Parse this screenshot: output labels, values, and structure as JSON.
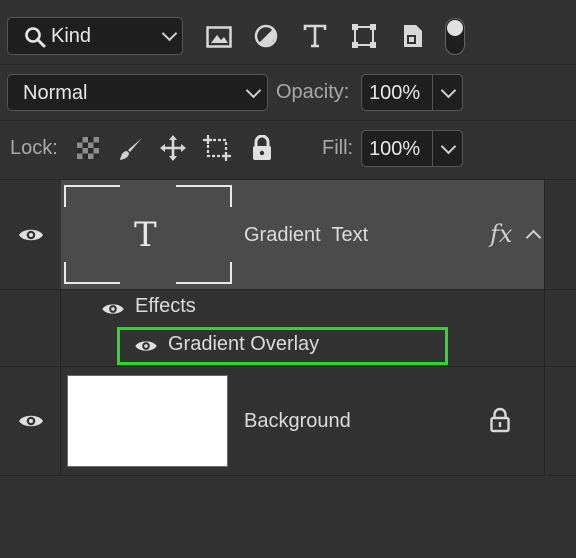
{
  "filter": {
    "kind_label": "Kind",
    "icons": [
      "image-filter-icon",
      "adjustment-filter-icon",
      "type-filter-icon",
      "shape-filter-icon",
      "smart-object-filter-icon",
      "filter-toggle-icon"
    ]
  },
  "blend": {
    "mode": "Normal",
    "opacity_label": "Opacity:",
    "opacity_value": "100%"
  },
  "lock": {
    "label": "Lock:",
    "icons": [
      "lock-transparent-pixels-icon",
      "lock-image-pixels-icon",
      "lock-position-icon",
      "lock-artboard-icon",
      "lock-all-icon"
    ],
    "fill_label": "Fill:",
    "fill_value": "100%"
  },
  "layers": [
    {
      "name": "Gradient  Text",
      "thumb_glyph": "T",
      "fx_label": "fx",
      "effects_label": "Effects",
      "effect": "Gradient Overlay"
    },
    {
      "name": "Background"
    }
  ],
  "colors": {
    "panel_bg": "#323232",
    "selected_row": "#4b4b4b",
    "highlight_border": "#1de21d"
  }
}
